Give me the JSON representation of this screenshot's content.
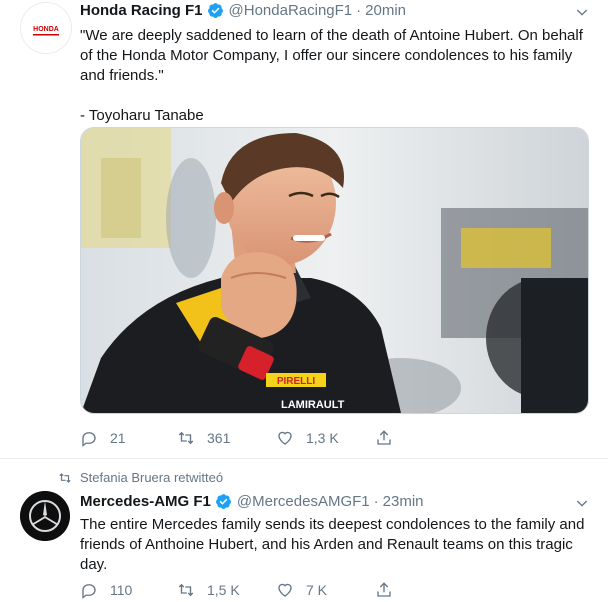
{
  "tweet1": {
    "name": "Honda Racing F1",
    "handle": "@HondaRacingF1",
    "dot": "·",
    "time": "20min",
    "avatar_text": "HONDA",
    "text_lines": [
      "\"We are deeply saddened to learn of the death of Antoine Hubert. On behalf",
      "of the Honda Motor Company, I offer our sincere condolences to his family",
      "and friends.\""
    ],
    "signature": "- Toyoharu Tanabe",
    "replies": "21",
    "retweets": "361",
    "likes": "1,3 K",
    "photo_text": "LAMIRAULT",
    "photo_brand": "PIRELLI"
  },
  "retweet_label": "Stefania Bruera retwitteó",
  "tweet2": {
    "name": "Mercedes-AMG F1",
    "handle": "@MercedesAMGF1",
    "dot": "·",
    "time": "23min",
    "text_lines": [
      "The entire Mercedes family sends its deepest condolences to the family and",
      "friends of Anthoine Hubert, and his Arden and Renault teams on this tragic",
      "day."
    ],
    "replies": "110",
    "retweets": "1,5 K",
    "likes": "7 K"
  },
  "colors": {
    "text": "#14171a",
    "secondary": "#657786",
    "verified": "#1da1f2",
    "honda_red": "#cc0000"
  },
  "icons": [
    "verified-badge-icon",
    "chevron-down-icon",
    "reply-icon",
    "retweet-icon",
    "like-icon",
    "share-icon"
  ]
}
